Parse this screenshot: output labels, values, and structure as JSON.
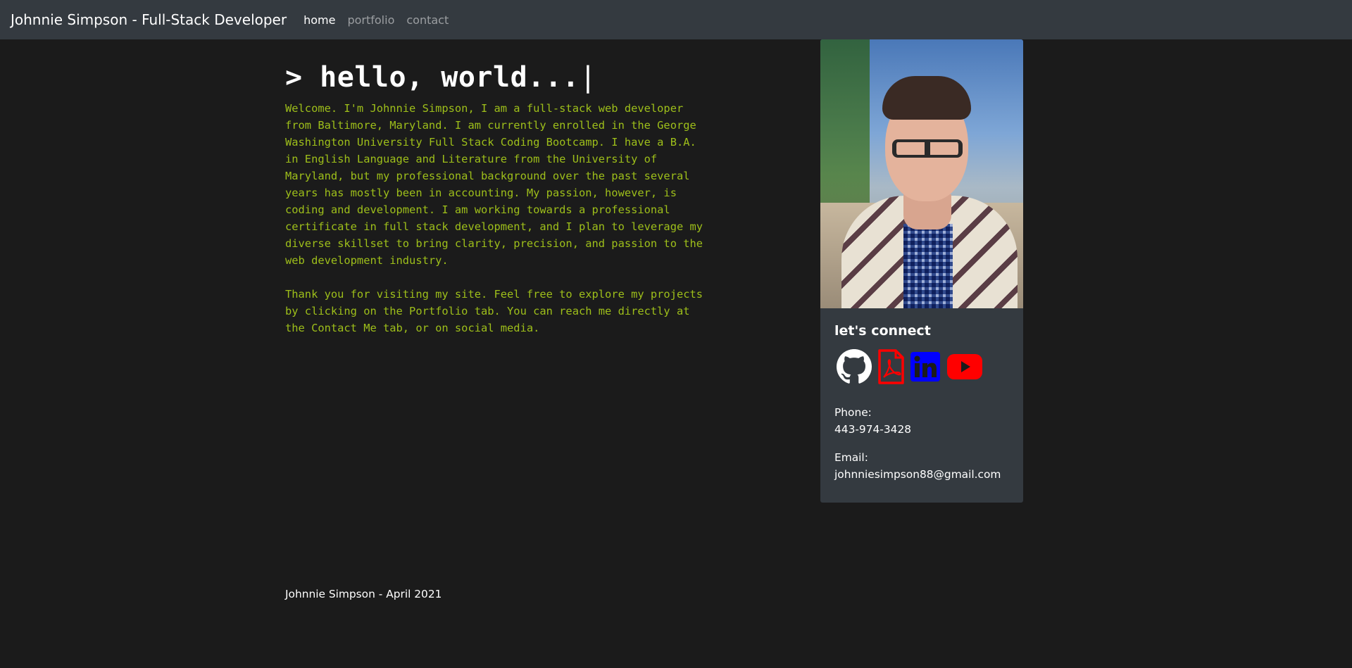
{
  "navbar": {
    "brand": "Johnnie Simpson - Full-Stack Developer",
    "links": [
      {
        "label": "home",
        "active": true
      },
      {
        "label": "portfolio",
        "active": false
      },
      {
        "label": "contact",
        "active": false
      }
    ]
  },
  "hero": {
    "heading": "> hello, world...",
    "cursor": "|",
    "paragraphs": [
      "Welcome. I'm Johnnie Simpson, I am a full-stack web developer from Baltimore, Maryland. I am currently enrolled in the George Washington University Full Stack Coding Bootcamp. I have a B.A. in English Language and Literature from the University of Maryland, but my professional background over the past several years has mostly been in accounting. My passion, however, is coding and development. I am working towards a professional certificate in full stack development, and I plan to leverage my diverse skillset to bring clarity, precision, and passion to the web development industry.",
      "Thank you for visiting my site. Feel free to explore my projects by clicking on the Portfolio tab. You can reach me directly at the Contact Me tab, or on social media."
    ]
  },
  "sidebar": {
    "connect_title": "let's connect",
    "icons": [
      "github-icon",
      "pdf-icon",
      "linkedin-icon",
      "youtube-icon"
    ],
    "phone_label": "Phone:",
    "phone": "443-974-3428",
    "email_label": "Email:",
    "email": "johnniesimpson88@gmail.com"
  },
  "colors": {
    "background": "#1b1b1b",
    "navbar": "#343a40",
    "bio_text": "#9ebf1a",
    "pdf": "#ff0000",
    "linkedin": "#0000ff",
    "youtube": "#ff0000"
  },
  "footer": {
    "text": "Johnnie Simpson - April 2021"
  }
}
